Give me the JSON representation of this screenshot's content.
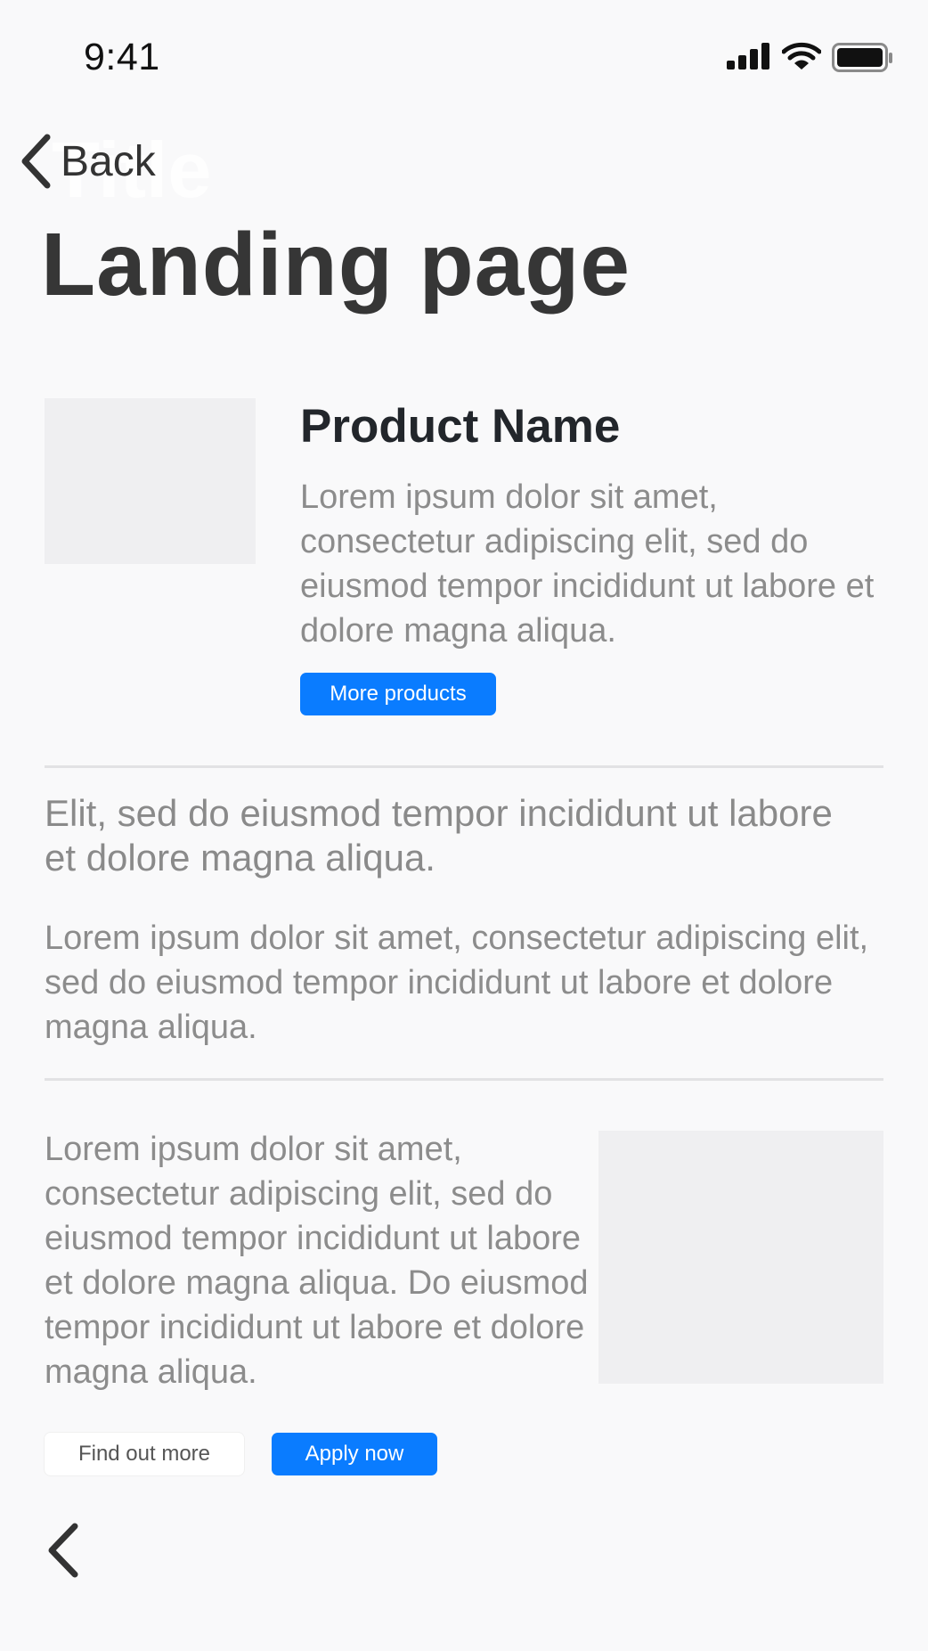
{
  "status_bar": {
    "time": "9:41",
    "icons": [
      "cellular-signal-icon",
      "wifi-icon",
      "battery-icon"
    ]
  },
  "nav": {
    "back_label": "Back",
    "ghost_title": "Title",
    "back_icon": "chevron-left-icon"
  },
  "page": {
    "title": "Landing page"
  },
  "product": {
    "name": "Product Name",
    "description": "Lorem ipsum dolor sit amet, consectetur adipiscing elit, sed do eiusmod tempor incididunt ut labore et dolore magna aliqua.",
    "button_label": "More products"
  },
  "section": {
    "lead": "Elit, sed do eiusmod tempor incididunt ut labore et dolore magna aliqua.",
    "paragraph": "Lorem ipsum dolor sit amet, consectetur adipiscing elit, sed do eiusmod tempor incididunt ut labore et dolore magna aliqua."
  },
  "feature": {
    "paragraph": "Lorem ipsum dolor sit amet, consectetur adipiscing elit, sed do eiusmod tempor incididunt ut labore et dolore magna aliqua. Do eiusmod tempor incididunt ut labore et dolore magna aliqua.",
    "secondary_button": "Find out more",
    "primary_button": "Apply now"
  },
  "footer": {
    "back_icon": "chevron-left-icon"
  },
  "colors": {
    "background": "#f9f9fa",
    "accent": "#0a7cff",
    "placeholder": "#efeff1",
    "body_text": "#8c8c8c",
    "heading": "#363636"
  }
}
